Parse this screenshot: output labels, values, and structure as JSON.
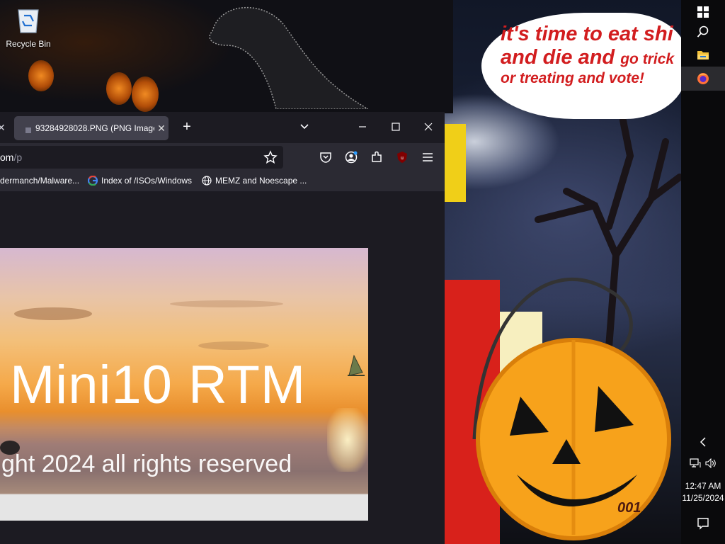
{
  "desktop": {
    "icons": [
      {
        "label": "Recycle Bin",
        "icon": "recycle-bin-icon"
      }
    ]
  },
  "wallpaper": {
    "speech_line1": "it's time to eat shi",
    "speech_line2a": "and die and",
    "speech_line2b": "go trick",
    "speech_line3": "or treating and vote!",
    "corner_text": "001"
  },
  "browser": {
    "tab_title": "93284928028.PNG (PNG Image,",
    "url_visible": "om",
    "url_path": "/p",
    "bookmarks": [
      {
        "label": "dermanch/Malware...",
        "icon": "github-icon"
      },
      {
        "label": "Index of /ISOs/Windows",
        "icon": "google-icon"
      },
      {
        "label": "MEMZ and Noescape ...",
        "icon": "globe-icon"
      }
    ],
    "image": {
      "title": "Mini10 RTM",
      "copyright": "ght 2024 all rights reserved"
    }
  },
  "taskbar": {
    "time": "12:47 AM",
    "date": "11/25/2024"
  },
  "colors": {
    "tab_bg": "#42414d",
    "toolbar_bg": "#2b2a33",
    "speech_red": "#d21d1f",
    "pumpkin": "#f7a21b"
  }
}
